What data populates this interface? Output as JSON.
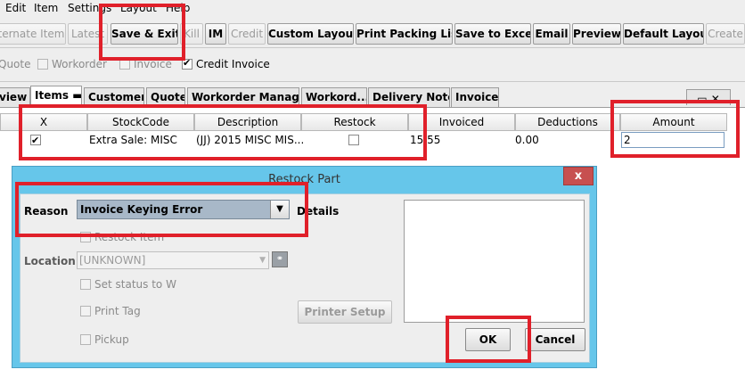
{
  "menu": [
    "Edit",
    "Item",
    "Settings",
    "Layout",
    "Help"
  ],
  "toolbar": {
    "buttons": [
      {
        "label": "ternate Item",
        "enabled": false
      },
      {
        "label": "Latest",
        "enabled": false
      },
      {
        "label": "Save & Exit",
        "enabled": true
      },
      {
        "label": "Kill",
        "enabled": false
      },
      {
        "label": "IM",
        "enabled": true
      },
      {
        "label": "Credit",
        "enabled": false
      },
      {
        "label": "Custom Layout",
        "enabled": true
      },
      {
        "label": "Print Packing List",
        "enabled": true
      },
      {
        "label": "Save to Excel",
        "enabled": true
      },
      {
        "label": "Email",
        "enabled": true
      },
      {
        "label": "Preview",
        "enabled": true
      },
      {
        "label": "Default Layout",
        "enabled": true
      },
      {
        "label": "Create",
        "enabled": false
      }
    ]
  },
  "filters": {
    "quote": {
      "label": "Quote",
      "checked": false
    },
    "workorder": {
      "label": "Workorder",
      "checked": false
    },
    "invoice": {
      "label": "Invoice",
      "checked": false
    },
    "credit_invoice": {
      "label": "Credit Invoice",
      "checked": true
    }
  },
  "tabs": [
    "view",
    "Items",
    "Customer",
    "Quote",
    "Workorder Manag...",
    "Workord...",
    "Delivery Notes",
    "Invoice"
  ],
  "table": {
    "headers": [
      "X",
      "StockCode",
      "Description",
      "Restock",
      "Invoiced",
      "Deductions",
      "Amount"
    ],
    "row": {
      "x_checked": true,
      "stockcode": "Extra Sale: MISC",
      "description": "(JJ) 2015 MISC MIS...",
      "restock_checked": false,
      "invoiced": "15.55",
      "deductions": "0.00",
      "amount": "2"
    }
  },
  "dialog": {
    "title": "Restock Part",
    "close": "x",
    "reason_label": "Reason",
    "reason_value": "Invoice Keying Error",
    "details_label": "Details",
    "restock_item_label": "Restock Item",
    "location_label": "Location",
    "location_value": "[UNKNOWN]",
    "set_status_label": "Set status to W",
    "print_tag_label": "Print Tag",
    "pickup_label": "Pickup",
    "printer_setup_label": "Printer Setup",
    "ok_label": "OK",
    "cancel_label": "Cancel"
  },
  "colors": {
    "dialog_frame": "#66c6ea",
    "close_button": "#c75050",
    "annotation_red": "#e0202a",
    "combo_selected": "#a8b8c8"
  }
}
